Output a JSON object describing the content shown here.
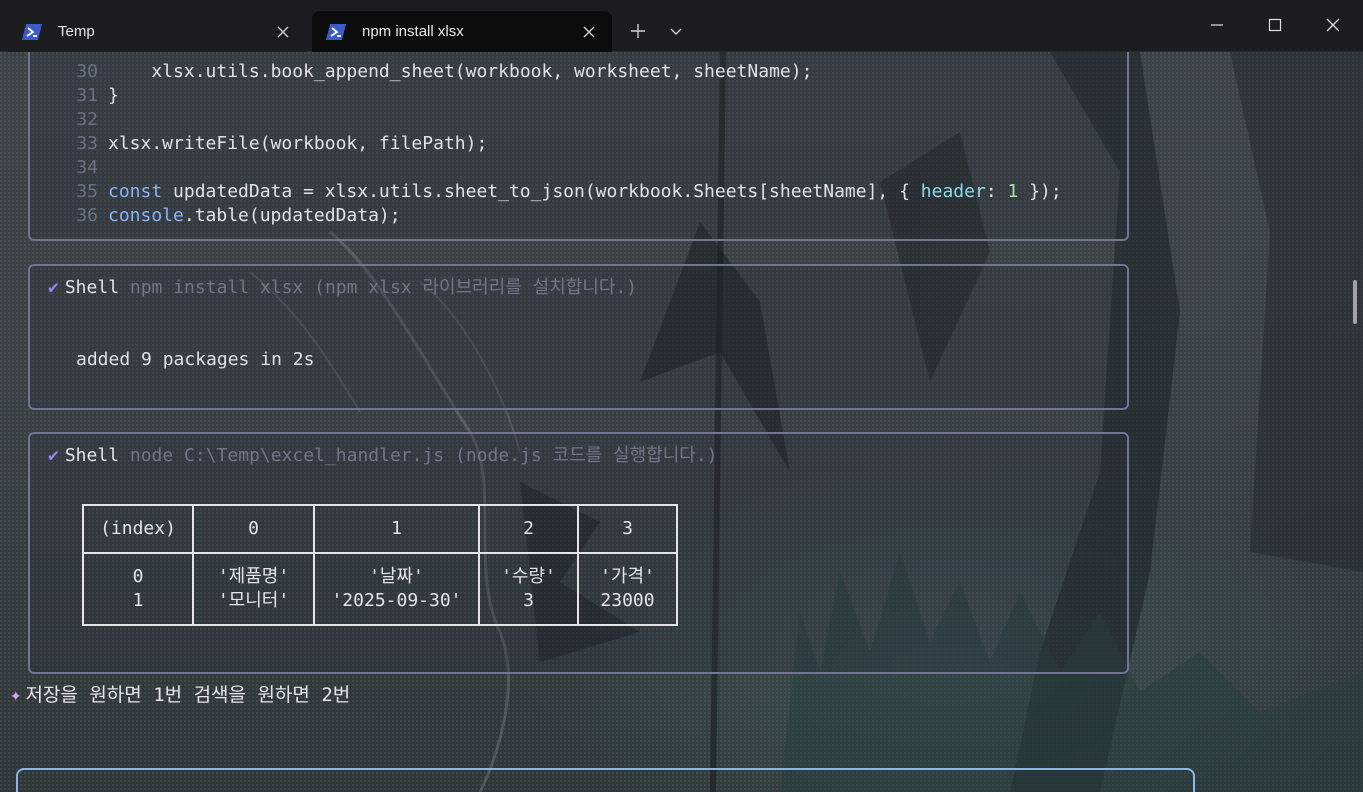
{
  "tabs": [
    {
      "label": "Temp",
      "active": false
    },
    {
      "label": "npm install xlsx",
      "active": true
    }
  ],
  "code": {
    "lines": [
      {
        "num": "30",
        "indent": "    ",
        "tokens": [
          [
            "plain",
            "xlsx.utils.book_append_sheet(workbook, worksheet, sheetName);"
          ]
        ]
      },
      {
        "num": "31",
        "indent": "",
        "tokens": [
          [
            "plain",
            "}"
          ]
        ]
      },
      {
        "num": "32",
        "indent": "",
        "tokens": []
      },
      {
        "num": "33",
        "indent": "",
        "tokens": [
          [
            "plain",
            "xlsx.writeFile(workbook, filePath);"
          ]
        ]
      },
      {
        "num": "34",
        "indent": "",
        "tokens": []
      },
      {
        "num": "35",
        "indent": "",
        "tokens": [
          [
            "kw",
            "const"
          ],
          [
            "plain",
            " updatedData = xlsx.utils.sheet_to_json(workbook.Sheets[sheetName], { "
          ],
          [
            "prop",
            "header"
          ],
          [
            "plain",
            ": "
          ],
          [
            "num",
            "1"
          ],
          [
            "plain",
            " });"
          ]
        ]
      },
      {
        "num": "36",
        "indent": "",
        "tokens": [
          [
            "kw",
            "console"
          ],
          [
            "plain",
            ".table(updatedData);"
          ]
        ]
      }
    ]
  },
  "shell1": {
    "word": "Shell",
    "command": "npm install xlsx (npm xlsx 라이브러리를 설치합니다.)",
    "output": "added 9 packages in 2s"
  },
  "shell2": {
    "word": "Shell",
    "command": "node C:\\Temp\\excel_handler.js (node.js 코드를 실행합니다.)",
    "table": {
      "headers": [
        "(index)",
        "0",
        "1",
        "2",
        "3"
      ],
      "rows": [
        [
          "0",
          "'제품명'",
          "'날짜'",
          "'수량'",
          "'가격'"
        ],
        [
          "1",
          "'모니터'",
          "'2025-09-30'",
          "3",
          "23000"
        ]
      ]
    }
  },
  "prompt": {
    "text": "저장을 원하면 1번 검색을 원하면 2번"
  }
}
